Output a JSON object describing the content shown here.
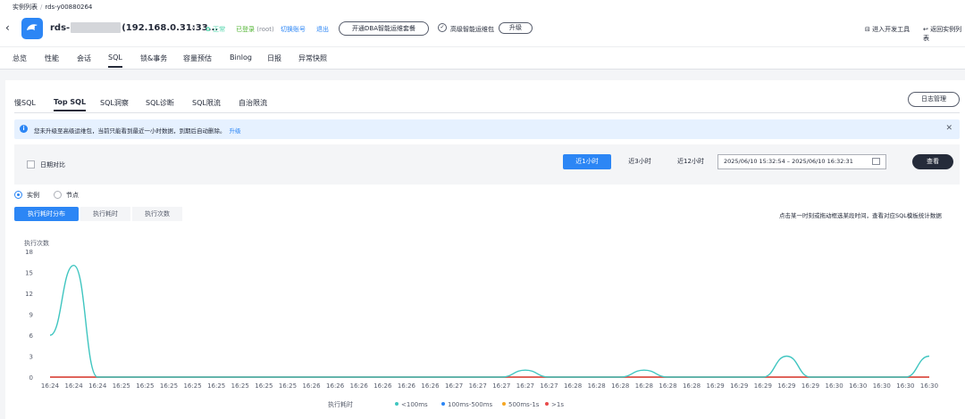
{
  "breadcrumb": {
    "parent": "实例列表",
    "current": "rds-y00880264"
  },
  "instance": {
    "name_prefix": "rds-",
    "name_suffix": "(192.168.0.31:33...",
    "dropdown_icon": "chevron-down-icon",
    "logo_icon": "rds-dolphin-icon"
  },
  "status": {
    "ok": "正常",
    "login": "已登录",
    "login_user": "(root)",
    "switch": "切换账号",
    "logout": "退出"
  },
  "header": {
    "dba_btn": "开通DBA智能运维套餐",
    "pkg_label": "高级智能运维包",
    "upgrade_btn": "升级",
    "dev_tool": "进入开发工具",
    "back_list": "返回实例列表"
  },
  "main_tabs": [
    "总览",
    "性能",
    "会话",
    "SQL",
    "锁&事务",
    "容量预估",
    "Binlog",
    "日报",
    "异常快照"
  ],
  "main_tab_active": "SQL",
  "sub_tabs": [
    "慢SQL",
    "Top SQL",
    "SQL洞察",
    "SQL诊断",
    "SQL限流",
    "自治限流"
  ],
  "sub_tab_active": "Top SQL",
  "log_btn": "日志管理",
  "info": {
    "text": "您未升级至高级运维包，当前只能看到最近一小时数据，到期后自动删除。",
    "link": "升级"
  },
  "filter": {
    "compare_label": "日期对比",
    "ranges": [
      "近1小时",
      "近3小时",
      "近12小时"
    ],
    "range_active": "近1小时",
    "date_range": "2025/06/10 15:32:54 – 2025/06/10 16:32:31",
    "query_btn": "查看"
  },
  "view": {
    "options": [
      "实例",
      "节点"
    ],
    "selected": "实例"
  },
  "segments": [
    "执行耗时分布",
    "执行耗时",
    "执行次数"
  ],
  "segment_active": "执行耗时分布",
  "chart_tip": "点击某一时刻或拖动框选某段时间，查看对应SQL模板统计数据",
  "chart_data": {
    "type": "line",
    "ylabel": "执行次数",
    "xlabel": "执行耗时",
    "ylim": [
      0,
      18
    ],
    "yticks": [
      0,
      3,
      6,
      9,
      12,
      15,
      18
    ],
    "x": [
      "16:24",
      "16:24",
      "16:24",
      "16:25",
      "16:25",
      "16:25",
      "16:25",
      "16:25",
      "16:25",
      "16:25",
      "16:25",
      "16:26",
      "16:26",
      "16:26",
      "16:26",
      "16:26",
      "16:26",
      "16:27",
      "16:27",
      "16:27",
      "16:27",
      "16:27",
      "16:28",
      "16:28",
      "16:28",
      "16:28",
      "16:28",
      "16:28",
      "16:29",
      "16:29",
      "16:29",
      "16:29",
      "16:29",
      "16:30",
      "16:30",
      "16:30",
      "16:30",
      "16:30"
    ],
    "series": [
      {
        "name": "<100ms",
        "color": "#3fc5c0",
        "values": [
          6,
          16,
          0,
          0,
          0,
          0,
          0,
          0,
          0,
          0,
          0,
          0,
          0,
          0,
          0,
          0,
          0,
          0,
          0,
          0,
          1,
          0,
          0,
          0,
          0,
          1,
          0,
          0,
          0,
          0,
          0,
          3,
          0,
          0,
          0,
          0,
          0,
          3
        ]
      },
      {
        "name": "100ms-500ms",
        "color": "#2c86f5",
        "values": [
          0,
          0,
          0,
          0,
          0,
          0,
          0,
          0,
          0,
          0,
          0,
          0,
          0,
          0,
          0,
          0,
          0,
          0,
          0,
          0,
          0,
          0,
          0,
          0,
          0,
          0,
          0,
          0,
          0,
          0,
          0,
          0,
          0,
          0,
          0,
          0,
          0,
          0
        ]
      },
      {
        "name": "500ms-1s",
        "color": "#f5a623",
        "values": [
          0,
          0,
          0,
          0,
          0,
          0,
          0,
          0,
          0,
          0,
          0,
          0,
          0,
          0,
          0,
          0,
          0,
          0,
          0,
          0,
          0,
          0,
          0,
          0,
          0,
          0,
          0,
          0,
          0,
          0,
          0,
          0,
          0,
          0,
          0,
          0,
          0,
          0
        ]
      },
      {
        "name": ">1s",
        "color": "#e84a4a",
        "values": [
          0,
          0,
          0,
          0,
          0,
          0,
          0,
          0,
          0,
          0,
          0,
          0,
          0,
          0,
          0,
          0,
          0,
          0,
          0,
          0,
          0,
          0,
          0,
          0,
          0,
          0,
          0,
          0,
          0,
          0,
          0,
          0,
          0,
          0,
          0,
          0,
          0,
          0
        ]
      }
    ],
    "legend_position": "bottom",
    "grid": false
  }
}
